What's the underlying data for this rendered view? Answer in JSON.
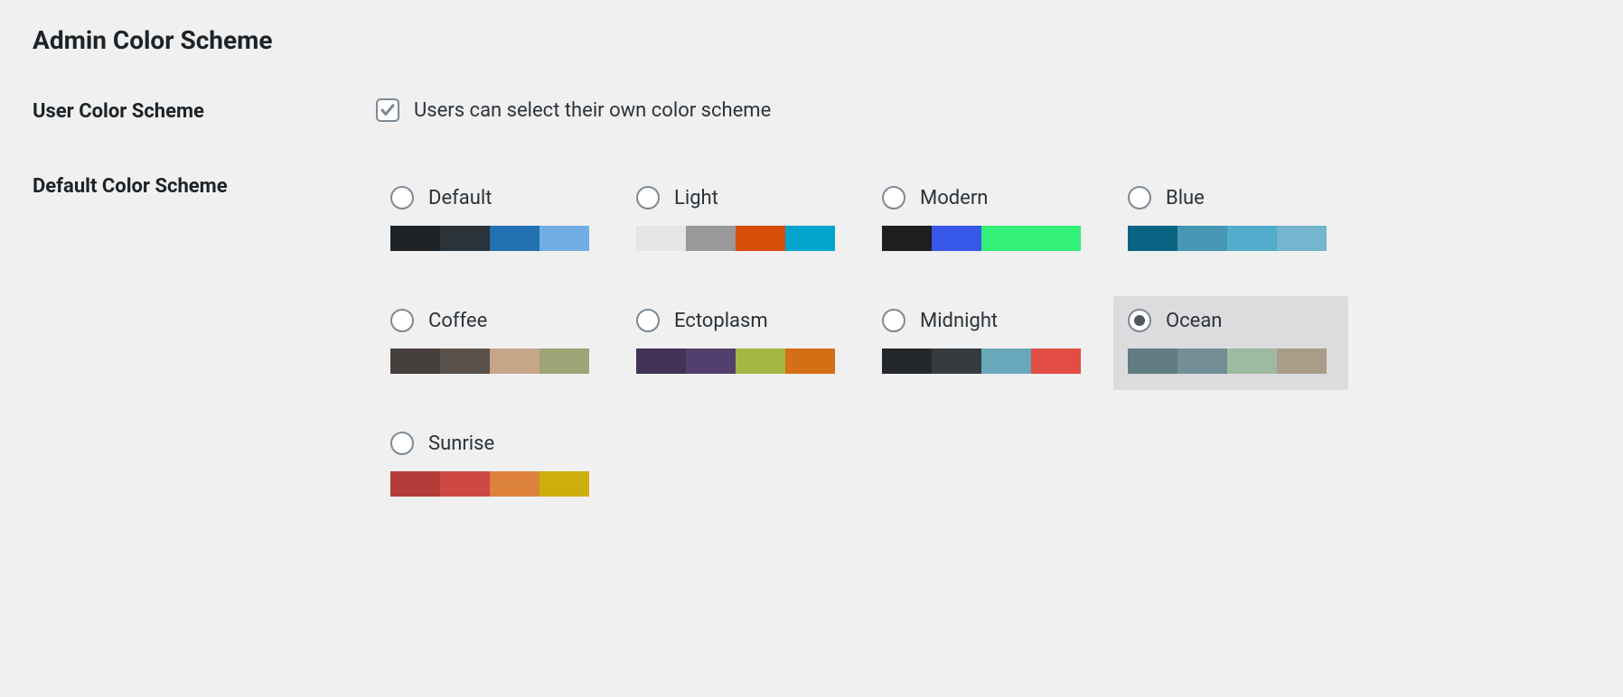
{
  "title": "Admin Color Scheme",
  "user_color_scheme": {
    "label": "User Color Scheme",
    "checkbox_label": "Users can select their own color scheme",
    "checked": true
  },
  "default_color_scheme": {
    "label": "Default Color Scheme",
    "selected": "ocean",
    "schemes": [
      {
        "id": "default",
        "name": "Default",
        "colors": [
          "#1d2327",
          "#2c3338",
          "#2271b1",
          "#72aee6"
        ]
      },
      {
        "id": "light",
        "name": "Light",
        "colors": [
          "#e5e5e5",
          "#999999",
          "#d64e07",
          "#04a4cc"
        ]
      },
      {
        "id": "modern",
        "name": "Modern",
        "colors": [
          "#1e1e1e",
          "#3858e9",
          "#33f078",
          "#33f078"
        ]
      },
      {
        "id": "blue",
        "name": "Blue",
        "colors": [
          "#096484",
          "#4796b3",
          "#52accc",
          "#74b6ce"
        ]
      },
      {
        "id": "coffee",
        "name": "Coffee",
        "colors": [
          "#46403c",
          "#59524c",
          "#c7a589",
          "#9ea476"
        ]
      },
      {
        "id": "ectoplasm",
        "name": "Ectoplasm",
        "colors": [
          "#413256",
          "#523f6d",
          "#a3b745",
          "#d46f15"
        ]
      },
      {
        "id": "midnight",
        "name": "Midnight",
        "colors": [
          "#25282b",
          "#363b3f",
          "#69a8bb",
          "#e14d43"
        ]
      },
      {
        "id": "ocean",
        "name": "Ocean",
        "colors": [
          "#627c83",
          "#738e96",
          "#9ebaa0",
          "#aa9d88"
        ]
      },
      {
        "id": "sunrise",
        "name": "Sunrise",
        "colors": [
          "#b43c38",
          "#cf4944",
          "#dd823b",
          "#ccaf0b"
        ]
      }
    ]
  }
}
